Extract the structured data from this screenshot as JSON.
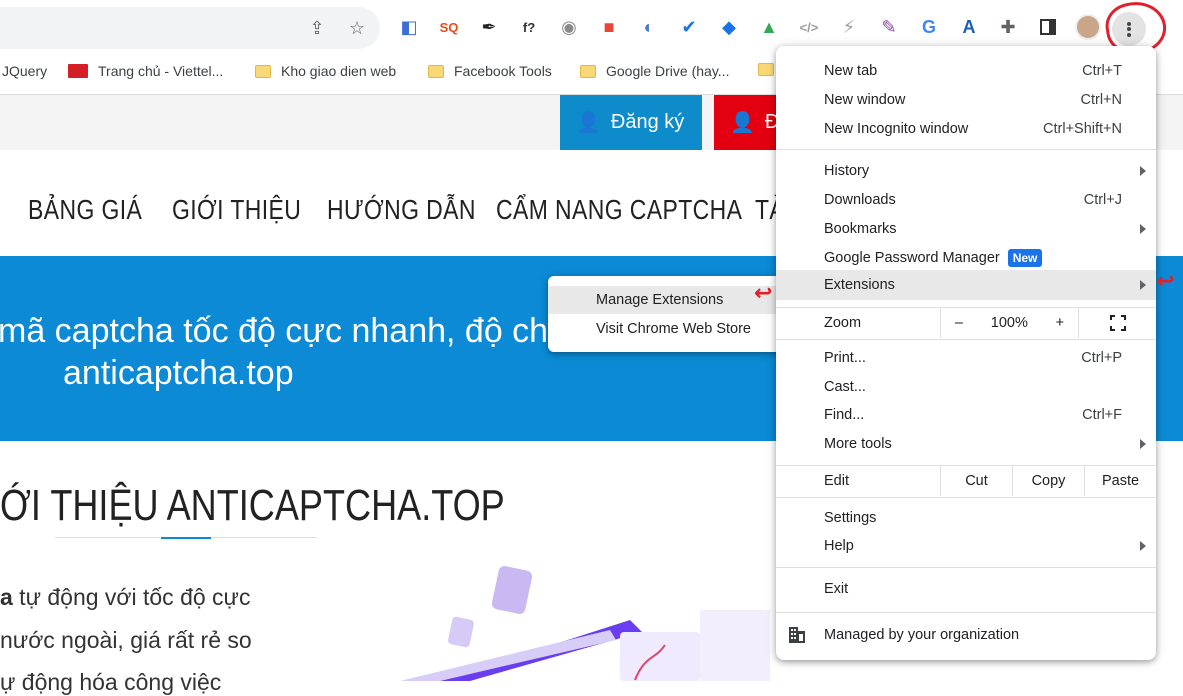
{
  "toolbar": {
    "extensions": [
      {
        "name": "screen-capture-ext-icon",
        "color": "#3b6fd4",
        "glyph": "◧"
      },
      {
        "name": "seoquake-ext-icon",
        "color": "#e74c1a",
        "glyph": "SQ"
      },
      {
        "name": "eyedropper-ext-icon",
        "color": "#222222",
        "glyph": "✒"
      },
      {
        "name": "font-finder-ext-icon",
        "color": "#333333",
        "glyph": "f?"
      },
      {
        "name": "camera-ext-icon",
        "color": "#8a8a8a",
        "glyph": "◉"
      },
      {
        "name": "color-picker-ext-icon",
        "color": "#e94435",
        "glyph": "■"
      },
      {
        "name": "globe-ext-icon",
        "color": "#4a7bd0",
        "glyph": "◐"
      },
      {
        "name": "check-ext-icon",
        "color": "#1a73e8",
        "glyph": "✔"
      },
      {
        "name": "tag-ext-icon",
        "color": "#1a73e8",
        "glyph": "◆"
      },
      {
        "name": "google-drive-ext-icon",
        "color": "#34a853",
        "glyph": "▲"
      },
      {
        "name": "code-ext-icon",
        "color": "#9e9e9e",
        "glyph": "</>"
      },
      {
        "name": "lightning-ext-icon",
        "color": "#9e9e9e",
        "glyph": "⚡"
      },
      {
        "name": "feather-ext-icon",
        "color": "#8e44ad",
        "glyph": "✎"
      },
      {
        "name": "translate-ext-icon",
        "color": "#4285f4",
        "glyph": "G"
      },
      {
        "name": "font-a-ext-icon",
        "color": "#1a5fb4",
        "glyph": "A"
      }
    ]
  },
  "bookmarks": [
    {
      "label": "JQuery",
      "type": "none"
    },
    {
      "label": "Trang chủ - Viettel...",
      "type": "viettel"
    },
    {
      "label": "Kho giao dien web",
      "type": "folder"
    },
    {
      "label": "Facebook Tools",
      "type": "folder"
    },
    {
      "label": "Google Drive (hay...",
      "type": "folder"
    }
  ],
  "site": {
    "register_label": "Đăng ký",
    "login_label": "Đ",
    "nav": [
      "BẢNG GIÁ",
      "GIỚI THIỆU",
      "HƯỚNG DẪN",
      "CẨM NANG CAPTCHA",
      "TÀ"
    ],
    "hero_line1": "mã captcha tốc độ cực nhanh, độ ch",
    "hero_line2": "anticaptcha.top",
    "about_heading": "ỚI THIỆU ANTICAPTCHA.TOP",
    "para1_bold": "a",
    "para1": " tự động với tốc độ cực",
    "para2": "nước ngoài, giá rất rẻ so",
    "para3": "ự động hóa công việc"
  },
  "menu": {
    "new_tab": "New tab",
    "new_tab_sc": "Ctrl+T",
    "new_window": "New window",
    "new_window_sc": "Ctrl+N",
    "incognito": "New Incognito window",
    "incognito_sc": "Ctrl+Shift+N",
    "history": "History",
    "downloads": "Downloads",
    "downloads_sc": "Ctrl+J",
    "bookmarks": "Bookmarks",
    "password_manager": "Google Password Manager",
    "new_badge": "New",
    "extensions": "Extensions",
    "zoom": "Zoom",
    "zoom_minus": "–",
    "zoom_value": "100%",
    "zoom_plus": "+",
    "print": "Print...",
    "print_sc": "Ctrl+P",
    "cast": "Cast...",
    "find": "Find...",
    "find_sc": "Ctrl+F",
    "more_tools": "More tools",
    "edit": "Edit",
    "cut": "Cut",
    "copy": "Copy",
    "paste": "Paste",
    "settings": "Settings",
    "help": "Help",
    "exit": "Exit",
    "managed": "Managed by your organization"
  },
  "submenu": {
    "manage_extensions": "Manage Extensions",
    "visit_store": "Visit Chrome Web Store"
  },
  "colors": {
    "hero_blue": "#0c8ad5",
    "register_blue": "#0e8bcb",
    "login_red": "#e30010",
    "annotation_red": "#e0202a"
  }
}
